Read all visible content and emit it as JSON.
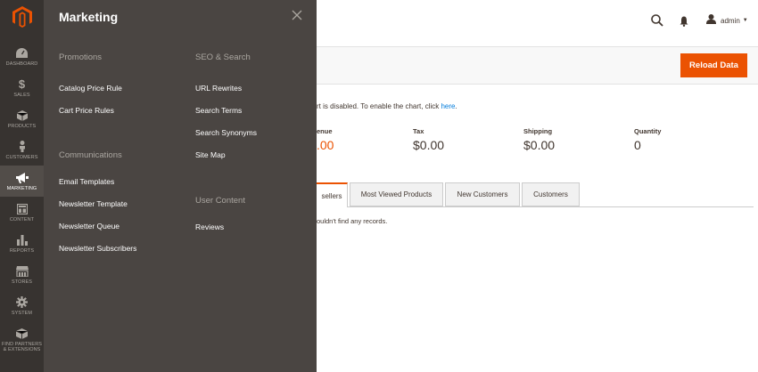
{
  "nav": {
    "items": [
      {
        "label": "DASHBOARD",
        "icon": "dashboard-icon"
      },
      {
        "label": "SALES",
        "icon": "dollar-icon"
      },
      {
        "label": "PRODUCTS",
        "icon": "box-icon"
      },
      {
        "label": "CUSTOMERS",
        "icon": "person-icon"
      },
      {
        "label": "MARKETING",
        "icon": "megaphone-icon"
      },
      {
        "label": "CONTENT",
        "icon": "layout-icon"
      },
      {
        "label": "REPORTS",
        "icon": "bar-chart-icon"
      },
      {
        "label": "STORES",
        "icon": "store-icon"
      },
      {
        "label": "SYSTEM",
        "icon": "gear-icon"
      },
      {
        "label": "FIND PARTNERS",
        "label2": "& EXTENSIONS",
        "icon": "cube-icon"
      }
    ]
  },
  "flyout": {
    "title": "Marketing",
    "col1": {
      "sections": [
        {
          "title": "Promotions",
          "links": [
            "Catalog Price Rule",
            "Cart Price Rules"
          ]
        },
        {
          "title": "Communications",
          "links": [
            "Email Templates",
            "Newsletter Template",
            "Newsletter Queue",
            "Newsletter Subscribers"
          ]
        }
      ]
    },
    "col2": {
      "sections": [
        {
          "title": "SEO & Search",
          "links": [
            "URL Rewrites",
            "Search Terms",
            "Search Synonyms",
            "Site Map"
          ]
        },
        {
          "title": "User Content",
          "links": [
            "Reviews"
          ]
        }
      ]
    }
  },
  "header": {
    "user": "admin"
  },
  "toolbar": {
    "reload_label": "Reload Data"
  },
  "chart_note": {
    "text": "rt is disabled. To enable the chart, click ",
    "link": "here",
    "tail": "."
  },
  "stats": [
    {
      "label": "enue",
      "value": ".00"
    },
    {
      "label": "Tax",
      "value": "$0.00"
    },
    {
      "label": "Shipping",
      "value": "$0.00"
    },
    {
      "label": "Quantity",
      "value": "0"
    }
  ],
  "tabs": [
    "sellers",
    "Most Viewed Products",
    "New Customers",
    "Customers"
  ],
  "grid": {
    "empty_text": "ouldn't find any records."
  },
  "colors": {
    "accent": "#eb5202",
    "nav_bg": "#373330",
    "flyout_bg": "#4a4542",
    "link": "#007bdb"
  }
}
